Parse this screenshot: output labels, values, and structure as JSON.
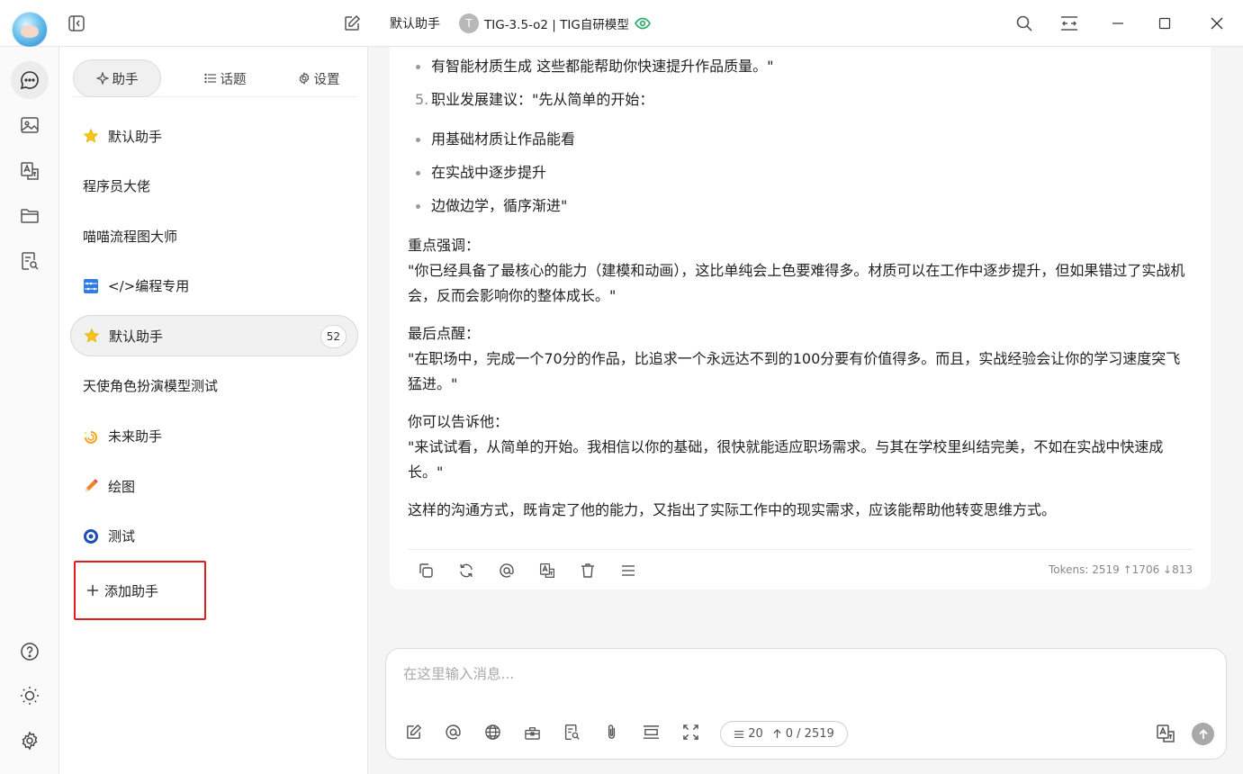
{
  "titlebar": {
    "assistant_title": "默认助手",
    "model_initial": "T",
    "model_name": "TIG-3.5-o2 | TIG自研模型"
  },
  "colors": {
    "accent_red": "#e11d1d",
    "model_eye": "#2eaa6e",
    "star": "#f5c518"
  },
  "side_tabs": [
    {
      "label": "助手",
      "icon": "sparkle-icon",
      "active": true
    },
    {
      "label": "话题",
      "icon": "list-icon",
      "active": false
    },
    {
      "label": "设置",
      "icon": "gear-icon",
      "active": false
    }
  ],
  "assistants": [
    {
      "label": "默认助手",
      "icon": "star-icon",
      "selected": false
    },
    {
      "label": "程序员大佬",
      "icon": "",
      "selected": false
    },
    {
      "label": "喵喵流程图大师",
      "icon": "",
      "selected": false
    },
    {
      "label": "</>编程专用",
      "icon": "abacus-icon",
      "selected": false
    },
    {
      "label": "默认助手",
      "icon": "star-icon",
      "selected": true,
      "badge": "52"
    },
    {
      "label": "天使角色扮演模型测试",
      "icon": "",
      "selected": false
    },
    {
      "label": "未来助手",
      "icon": "dizzy-icon",
      "selected": false
    },
    {
      "label": "绘图",
      "icon": "pencil-icon",
      "selected": false
    },
    {
      "label": "测试",
      "icon": "target-icon",
      "selected": false
    }
  ],
  "add_assistant_label": "添加助手",
  "message": {
    "bullet1": "有智能材质生成 这些都能帮助你快速提升作品质量。\"",
    "num5_index": "5.",
    "num5_text": "职业发展建议：\"先从简单的开始：",
    "bullet2": "用基础材质让作品能看",
    "bullet3": "在实战中逐步提升",
    "bullet4": "边做边学，循序渐进\"",
    "p1_title": "重点强调：",
    "p1_body": "\"你已经具备了最核心的能力（建模和动画），这比单纯会上色要难得多。材质可以在工作中逐步提升，但如果错过了实战机会，反而会影响你的整体成长。\"",
    "p2_title": "最后点醒：",
    "p2_body": "\"在职场中，完成一个70分的作品，比追求一个永远达不到的100分要有价值得多。而且，实战经验会让你的学习速度突飞猛进。\"",
    "p3_title": "你可以告诉他：",
    "p3_body": "\"来试试看，从简单的开始。我相信以你的基础，很快就能适应职场需求。与其在学校里纠结完美，不如在实战中快速成长。\"",
    "p4": "这样的沟通方式，既肯定了他的能力，又指出了实际工作中的现实需求，应该能帮助他转变思维方式。",
    "tokens": "Tokens: 2519 ↑1706 ↓813"
  },
  "input": {
    "placeholder": "在这里输入消息...",
    "context_count": "20",
    "token_count": "0 / 2519"
  }
}
